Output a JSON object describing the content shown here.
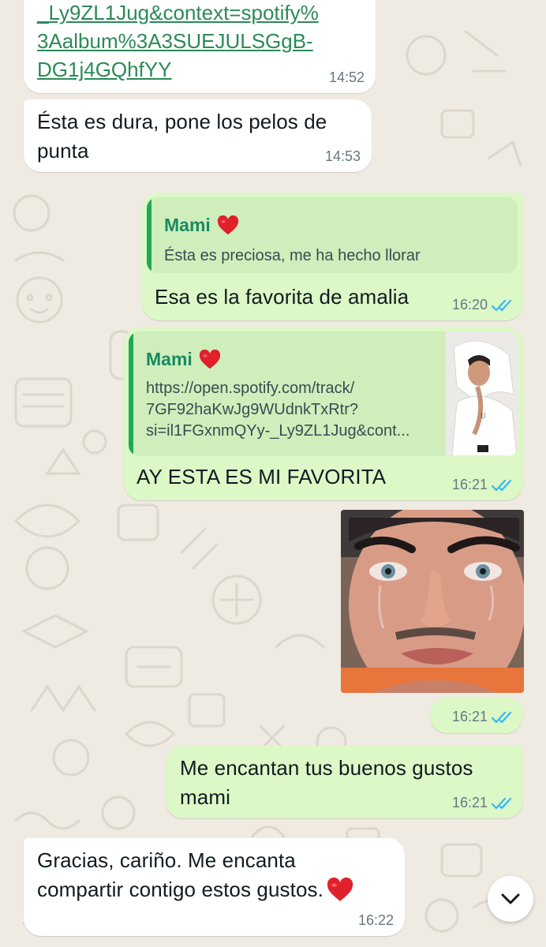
{
  "chat": {
    "link_msg": {
      "lines": [
        "_Ly9ZL1Jug&context=spotify%",
        "3Aalbum%3A3SUEJULSGgB-",
        "DG1j4GQhfYY"
      ],
      "time": "14:52"
    },
    "msg_dura": {
      "line1": "Ésta es dura, pone los pelos de",
      "line2": "punta",
      "time": "14:53"
    },
    "reply_amalia": {
      "quote_name": "Mami",
      "quote_text": "Ésta es preciosa, me ha hecho llorar",
      "text": "Esa es la favorita de amalia",
      "time": "16:20"
    },
    "reply_favorita": {
      "quote_name": "Mami",
      "quote_lines": [
        "https://open.spotify.com/track/",
        "7GF92haKwJg9WUdnkTxRtr?",
        "si=il1FGxnmQYy-_Ly9ZL1Jug&cont..."
      ],
      "album_cover_letter": "U",
      "text": "AY ESTA ES MI FAVORITA",
      "time": "16:21"
    },
    "photo_msg": {
      "time": "16:21"
    },
    "msg_gustos": {
      "line1": "Me encantan tus buenos gustos",
      "line2": "mami",
      "time": "16:21"
    },
    "msg_gracias": {
      "line1": "Gracias, cariño. Me encanta",
      "line2": "compartir contigo estos gustos.",
      "time": "16:22"
    }
  },
  "icons": {
    "read_receipt": "double-check-icon",
    "heart": "red-heart-icon",
    "scroll_down": "chevron-down-icon"
  },
  "colors": {
    "outgoing_bubble": "#dcf8c6",
    "incoming_bubble": "#ffffff",
    "read_tick": "#34b7f1",
    "quote_accent": "#1fa855",
    "link": "#2b8a57"
  }
}
